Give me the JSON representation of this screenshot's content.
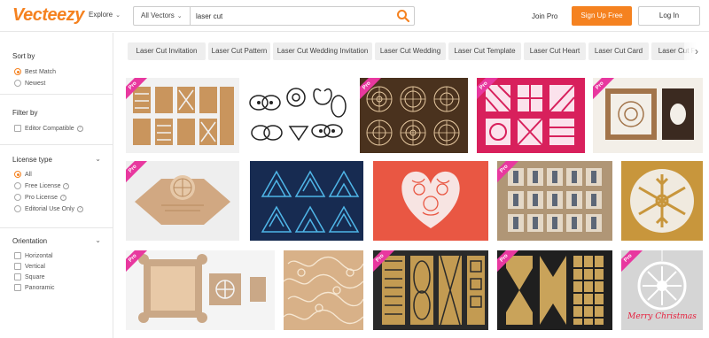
{
  "header": {
    "logo": "Vecteezy",
    "explore_label": "Explore",
    "category_label": "All Vectors",
    "search_value": "laser cut",
    "join_pro": "Join Pro",
    "sign_up": "Sign Up Free",
    "log_in": "Log In"
  },
  "sidebar": {
    "sort": {
      "title": "Sort by",
      "options": [
        "Best Match",
        "Newest"
      ],
      "selected": "Best Match"
    },
    "filter": {
      "title": "Filter by",
      "options": [
        "Editor Compatible"
      ]
    },
    "license": {
      "title": "License type",
      "options": [
        "All",
        "Free License",
        "Pro License",
        "Editorial Use Only"
      ],
      "selected": "All"
    },
    "orientation": {
      "title": "Orientation",
      "options": [
        "Horizontal",
        "Vertical",
        "Square",
        "Panoramic"
      ]
    }
  },
  "tags": [
    "Laser Cut Invitation",
    "Laser Cut Pattern",
    "Laser Cut Wedding Invitation",
    "Laser Cut Wedding",
    "Laser Cut Template",
    "Laser Cut Heart",
    "Laser Cut Card",
    "Laser Cut Fr"
  ],
  "pro_badge": "Pro",
  "grid": [
    {
      "row": 1,
      "desc": "laser cut panels on wood",
      "pro": true
    },
    {
      "row": 1,
      "desc": "butterfly and flower silhouettes",
      "pro": false
    },
    {
      "row": 1,
      "desc": "round mandala cutouts on brown",
      "pro": true
    },
    {
      "row": 1,
      "desc": "pink geometric cut patterns",
      "pro": true
    },
    {
      "row": 1,
      "desc": "ornamental invitation frame",
      "pro": true
    },
    {
      "row": 2,
      "desc": "laser cut envelope template",
      "pro": true
    },
    {
      "row": 2,
      "desc": "blue geometric triangles",
      "pro": false
    },
    {
      "row": 2,
      "desc": "floral lace heart on red",
      "pro": false
    },
    {
      "row": 2,
      "desc": "laser cut numbers",
      "pro": true
    },
    {
      "row": 2,
      "desc": "snowflake wood ornament",
      "pro": false
    },
    {
      "row": 3,
      "desc": "laser cut square envelope",
      "pro": true
    },
    {
      "row": 3,
      "desc": "ornamental pattern panel",
      "pro": false
    },
    {
      "row": 3,
      "desc": "gold decorative panels on black",
      "pro": true
    },
    {
      "row": 3,
      "desc": "geometric decorative panels",
      "pro": true
    },
    {
      "row": 3,
      "desc": "christmas ball ornament",
      "pro": true
    }
  ],
  "grid_caption": "Merry Christmas",
  "colors": {
    "brand": "#f58220",
    "pro_badge": "#e8389f"
  }
}
